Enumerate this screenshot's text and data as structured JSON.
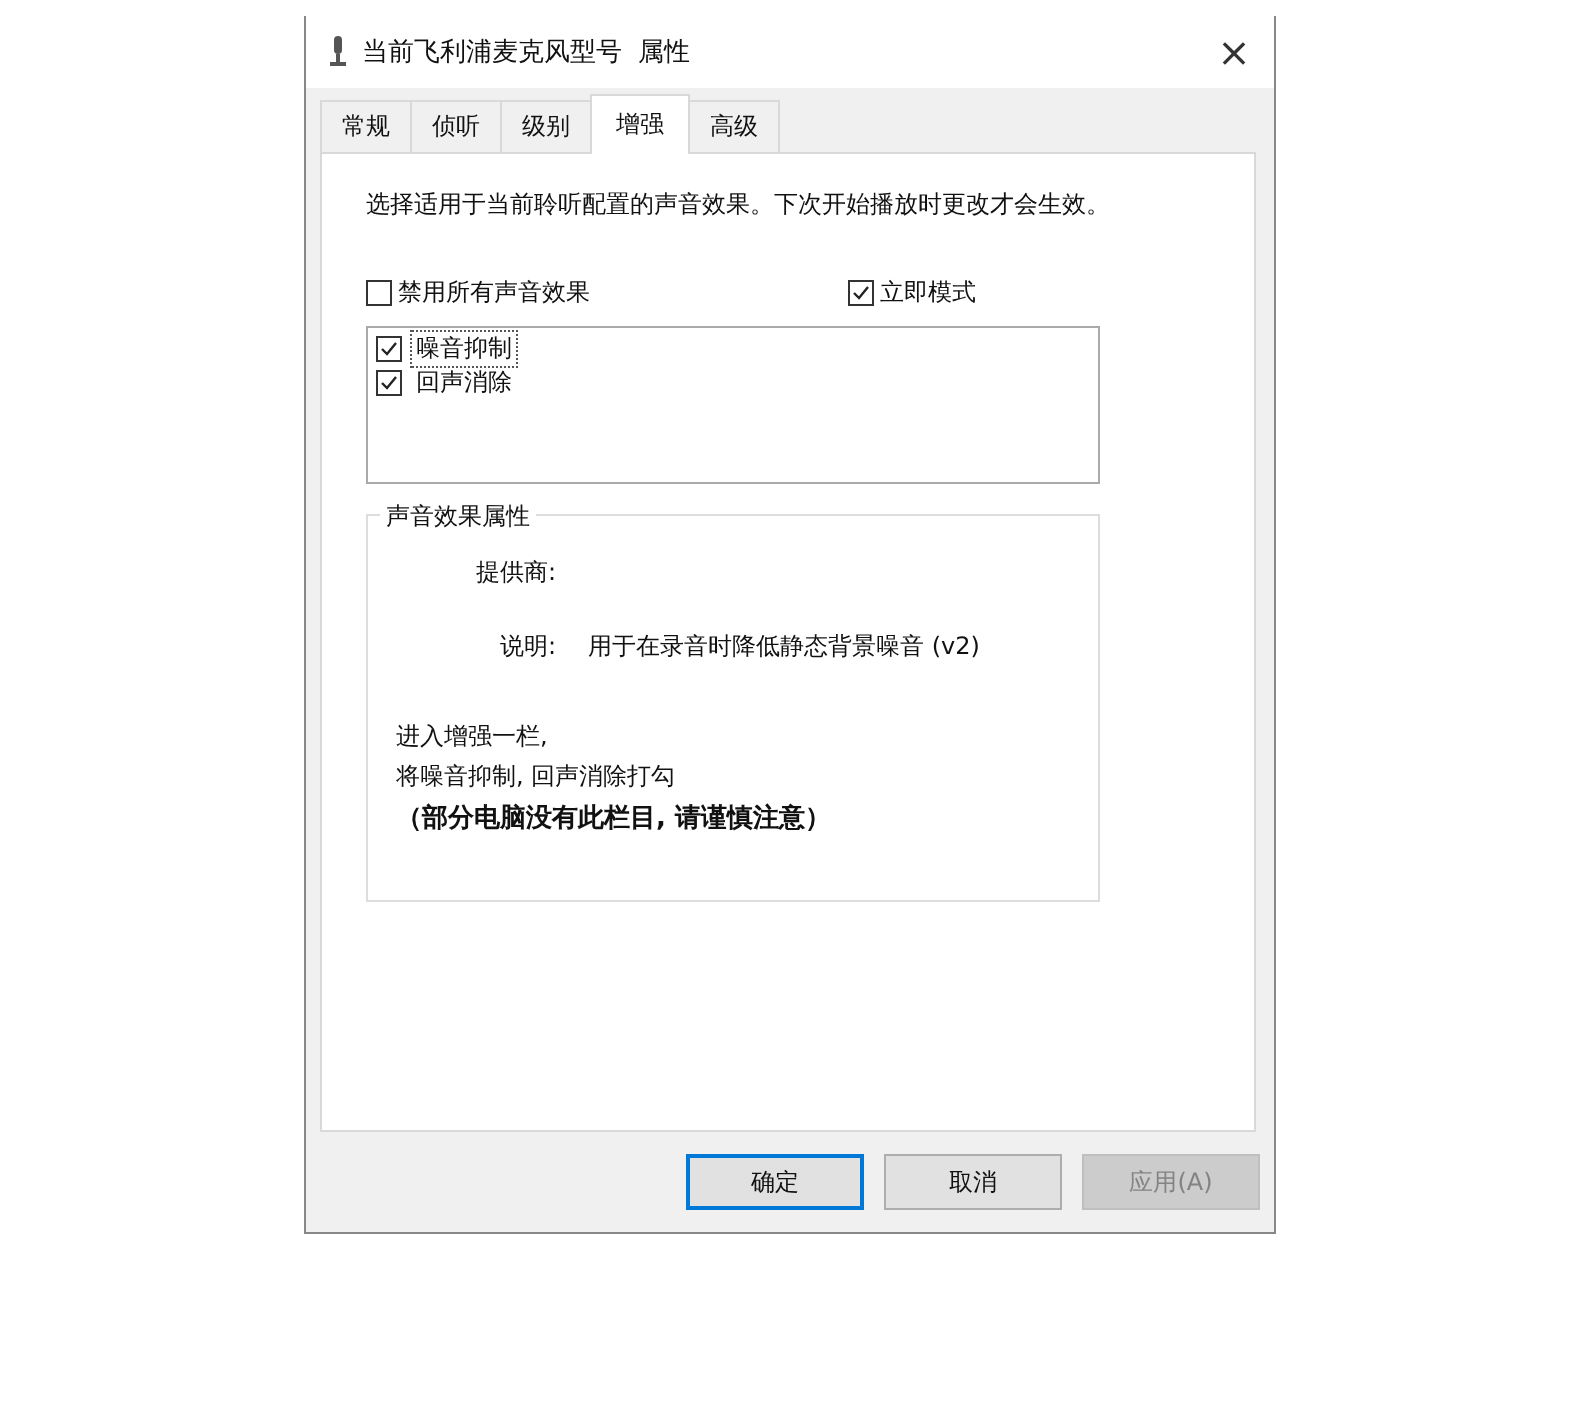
{
  "window": {
    "title": "当前飞利浦麦克风型号",
    "title_suffix": "属性",
    "close": "×"
  },
  "tabs": [
    {
      "label": "常规",
      "selected": false
    },
    {
      "label": "侦听",
      "selected": false
    },
    {
      "label": "级别",
      "selected": false
    },
    {
      "label": "增强",
      "selected": true
    },
    {
      "label": "高级",
      "selected": false
    }
  ],
  "description": "选择适用于当前聆听配置的声音效果。下次开始播放时更改才会生效。",
  "options": [
    {
      "label": "禁用所有声音效果",
      "checked": false
    },
    {
      "label": "立即模式",
      "checked": true
    }
  ],
  "effects": [
    {
      "label": "噪音抑制",
      "checked": true,
      "focused": true
    },
    {
      "label": "回声消除",
      "checked": true,
      "focused": false
    }
  ],
  "properties_group": {
    "title": "声音效果属性",
    "provider_label": "提供商:",
    "description_label": "说明:",
    "description_value": "用于在录音时降低静态背景噪音 (v2)"
  },
  "notes": [
    {
      "text": "进入增强一栏,",
      "kind": "plain"
    },
    {
      "text": "将噪音抑制, 回声消除打勾",
      "kind": "plain"
    },
    {
      "text": "（部分电脑没有此栏目, 请谨慎注意）",
      "kind": "bold"
    }
  ],
  "buttons": [
    {
      "label": "确定",
      "kind": "default"
    },
    {
      "label": "取消",
      "kind": "normal"
    },
    {
      "label": "应用(A)",
      "kind": "disabled"
    }
  ]
}
